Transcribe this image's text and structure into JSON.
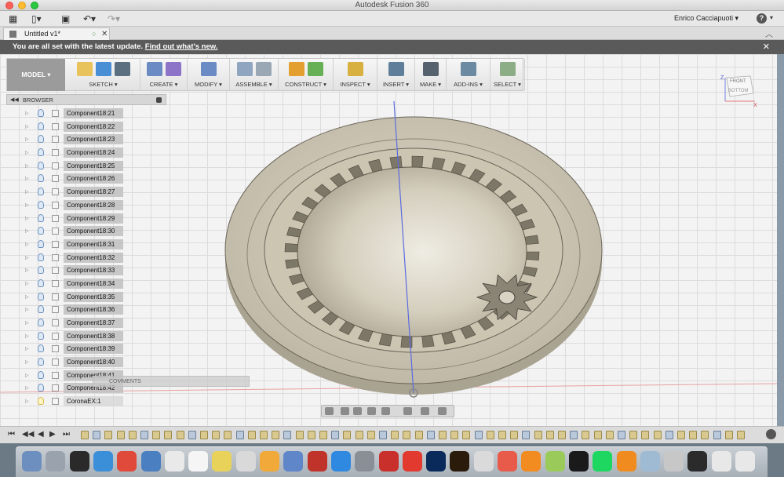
{
  "window": {
    "title": "Autodesk Fusion 360"
  },
  "app_toolbar": {
    "user_name": "Enrico Cacciapuoti ▾",
    "help_label": "?"
  },
  "document_tab": {
    "title": "Untitled v1*"
  },
  "banner": {
    "message": "You are all set with the latest update. ",
    "link": "Find out what's new."
  },
  "ribbon": {
    "workspace": "MODEL ▾",
    "groups": [
      {
        "label": "SKETCH ▾",
        "colors": [
          "#e8c25a",
          "#4a8fd6",
          "#5c6f80"
        ]
      },
      {
        "label": "CREATE ▾",
        "colors": [
          "#6b8bc4",
          "#8e74c9"
        ]
      },
      {
        "label": "MODIFY ▾",
        "colors": [
          "#6b8bc4"
        ]
      },
      {
        "label": "ASSEMBLE ▾",
        "colors": [
          "#8fa5c0",
          "#9aa7b4"
        ]
      },
      {
        "label": "CONSTRUCT ▾",
        "colors": [
          "#e3a030",
          "#67b055"
        ]
      },
      {
        "label": "INSPECT ▾",
        "colors": [
          "#d8b040"
        ]
      },
      {
        "label": "INSERT ▾",
        "colors": [
          "#5e7e99"
        ]
      },
      {
        "label": "MAKE ▾",
        "colors": [
          "#56636e"
        ]
      },
      {
        "label": "ADD-INS ▾",
        "colors": [
          "#6d8aa3"
        ]
      },
      {
        "label": "SELECT ▾",
        "colors": [
          "#8dad86"
        ]
      }
    ]
  },
  "browser": {
    "title": "BROWSER",
    "items": [
      "Component18:21",
      "Component18:22",
      "Component18:23",
      "Component18:24",
      "Component18:25",
      "Component18:26",
      "Component18:27",
      "Component18:28",
      "Component18:29",
      "Component18:30",
      "Component18:31",
      "Component18:32",
      "Component18:33",
      "Component18:34",
      "Component18:35",
      "Component18:36",
      "Component18:37",
      "Component18:38",
      "Component18:39",
      "Component18:40",
      "Component18:41",
      "Component18:42",
      "CoronaEX:1"
    ],
    "comments_label": "COMMENTS"
  },
  "viewcube": {
    "front": "FRONT",
    "bottom": "BOTTOM",
    "axis_z": "Z",
    "axis_x": "X"
  },
  "colors": {
    "accent": "#6a90c0",
    "banner": "#5a5a5a",
    "model": "#9b9b9b"
  }
}
